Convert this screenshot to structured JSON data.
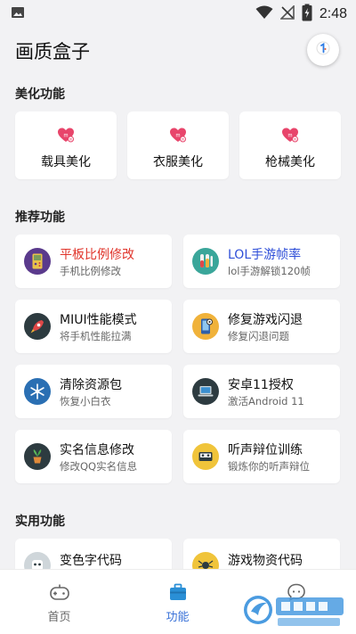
{
  "status_bar": {
    "time": "2:48",
    "icons": [
      "image-icon",
      "wifi-icon",
      "no-signal-icon",
      "battery-charging-icon"
    ]
  },
  "app": {
    "title": "画质盒子",
    "header_button_icon": "version-info-icon"
  },
  "sections": {
    "beauty": {
      "title": "美化功能"
    },
    "recommended": {
      "title": "推荐功能"
    },
    "practical": {
      "title": "实用功能"
    }
  },
  "beauty_items": [
    {
      "label": "载具美化",
      "icon": "pink-heart-m-icon"
    },
    {
      "label": "衣服美化",
      "icon": "pink-heart-m-icon"
    },
    {
      "label": "枪械美化",
      "icon": "pink-heart-m-icon"
    }
  ],
  "recommended_items": [
    {
      "title": "平板比例修改",
      "subtitle": "手机比例修改",
      "icon": "gameboy-icon",
      "title_color": "#e0352b"
    },
    {
      "title": "LOL手游帧率",
      "subtitle": "lol手游解锁120帧",
      "icon": "test-tubes-icon",
      "title_color": "#2f4fd8"
    },
    {
      "title": "MIUI性能模式",
      "subtitle": "将手机性能拉满",
      "icon": "rocket-icon",
      "title_color": "#111111"
    },
    {
      "title": "修复游戏闪退",
      "subtitle": "修复闪退问题",
      "icon": "phone-repair-icon",
      "title_color": "#111111"
    },
    {
      "title": "清除资源包",
      "subtitle": "恢复小白衣",
      "icon": "snowflake-icon",
      "title_color": "#111111"
    },
    {
      "title": "安卓11授权",
      "subtitle": "激活Android 11",
      "icon": "laptop-icon",
      "title_color": "#111111"
    },
    {
      "title": "实名信息修改",
      "subtitle": "修改QQ实名信息",
      "icon": "plant-pot-icon",
      "title_color": "#111111"
    },
    {
      "title": "听声辩位训练",
      "subtitle": "锻炼你的听声辩位",
      "icon": "cassette-icon",
      "title_color": "#111111"
    }
  ],
  "practical_items": [
    {
      "title": "变色字代码",
      "icon": "robot-face-icon"
    },
    {
      "title": "游戏物资代码",
      "icon": "spider-icon"
    }
  ],
  "bottom_nav": [
    {
      "label": "首页",
      "icon": "gamepad-icon",
      "active": false
    },
    {
      "label": "功能",
      "icon": "toolbox-icon",
      "active": true
    },
    {
      "label": "",
      "icon": "chat-bubble-icon",
      "active": false
    }
  ],
  "colors": {
    "background": "#f2f2f4",
    "accent_blue": "#3a72d8",
    "red_title": "#e0352b",
    "blue_title": "#2f4fd8",
    "beauty_pink": "#e8456b"
  },
  "watermark": {
    "icon": "site-watermark-logo"
  }
}
